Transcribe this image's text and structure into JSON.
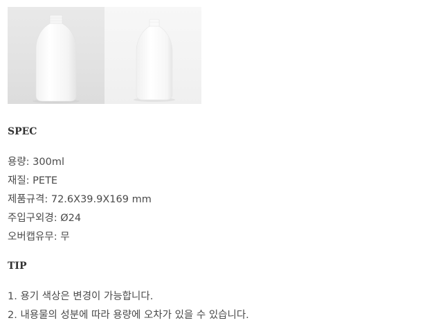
{
  "images": [
    {
      "alt": "white bottle front view"
    },
    {
      "alt": "white bottle angled view"
    }
  ],
  "spec": {
    "heading": "SPEC",
    "lines": [
      "용량: 300ml",
      "재질: PETE",
      "제품규격: 72.6X39.9X169 mm",
      "주입구외경: Ø24",
      "오버캡유무: 무"
    ]
  },
  "tip": {
    "heading": "TIP",
    "lines": [
      "1. 용기 색상은 변경이 가능합니다.",
      "2. 내용물의 성분에 따라 용량에 오차가 있을 수 있습니다."
    ]
  }
}
